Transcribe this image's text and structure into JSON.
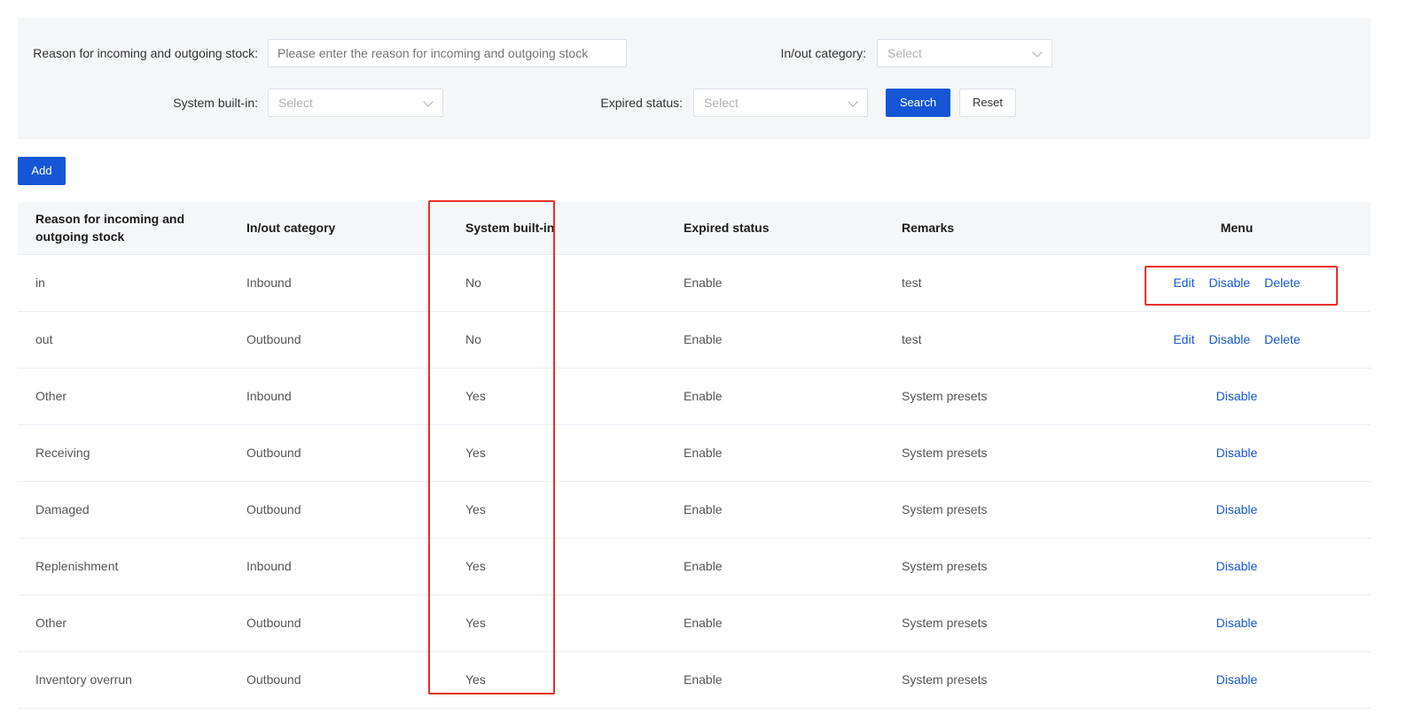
{
  "filters": {
    "reason_label": "Reason for incoming and outgoing stock:",
    "reason_placeholder": "Please enter the reason for incoming and outgoing stock",
    "category_label": "In/out category:",
    "category_value": "Select",
    "builtin_label": "System built-in:",
    "builtin_value": "Select",
    "expired_label": "Expired status:",
    "expired_value": "Select",
    "search_label": "Search",
    "reset_label": "Reset"
  },
  "toolbar": {
    "add_label": "Add"
  },
  "table": {
    "columns": [
      "Reason for incoming and outgoing stock",
      "In/out category",
      "System built-in",
      "Expired status",
      "Remarks",
      "Menu"
    ],
    "rows": [
      {
        "reason": "in",
        "category": "Inbound",
        "builtin": "No",
        "status": "Enable",
        "remarks": "test",
        "actions": [
          "Edit",
          "Disable",
          "Delete"
        ]
      },
      {
        "reason": "out",
        "category": "Outbound",
        "builtin": "No",
        "status": "Enable",
        "remarks": "test",
        "actions": [
          "Edit",
          "Disable",
          "Delete"
        ]
      },
      {
        "reason": "Other",
        "category": "Inbound",
        "builtin": "Yes",
        "status": "Enable",
        "remarks": "System presets",
        "actions": [
          "Disable"
        ]
      },
      {
        "reason": "Receiving",
        "category": "Outbound",
        "builtin": "Yes",
        "status": "Enable",
        "remarks": "System presets",
        "actions": [
          "Disable"
        ]
      },
      {
        "reason": "Damaged",
        "category": "Outbound",
        "builtin": "Yes",
        "status": "Enable",
        "remarks": "System presets",
        "actions": [
          "Disable"
        ]
      },
      {
        "reason": "Replenishment",
        "category": "Inbound",
        "builtin": "Yes",
        "status": "Enable",
        "remarks": "System presets",
        "actions": [
          "Disable"
        ]
      },
      {
        "reason": "Other",
        "category": "Outbound",
        "builtin": "Yes",
        "status": "Enable",
        "remarks": "System presets",
        "actions": [
          "Disable"
        ]
      },
      {
        "reason": "Inventory overrun",
        "category": "Outbound",
        "builtin": "Yes",
        "status": "Enable",
        "remarks": "System presets",
        "actions": [
          "Disable"
        ]
      }
    ]
  },
  "colors": {
    "primary": "#1556d6",
    "highlight": "#e8312a",
    "panel": "#f5f6f8"
  }
}
